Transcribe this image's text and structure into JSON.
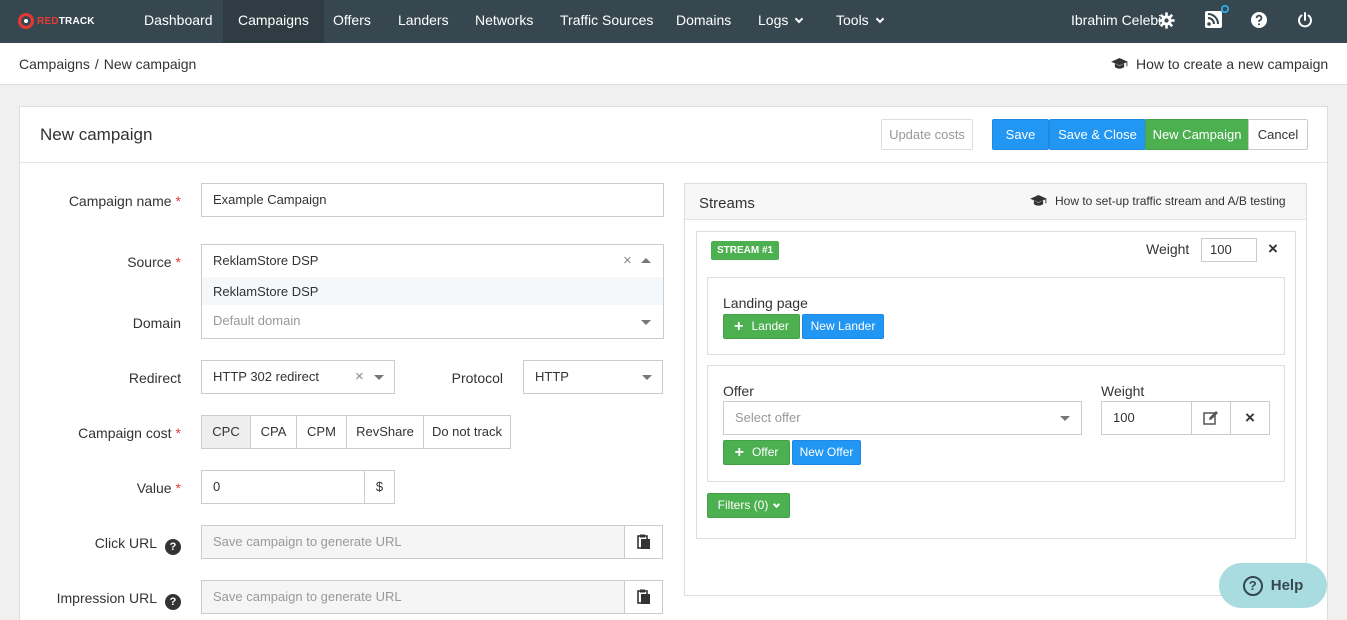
{
  "logo": {
    "text_red": "RED",
    "text_white": "TRACK"
  },
  "nav": {
    "items": [
      "Dashboard",
      "Campaigns",
      "Offers",
      "Landers",
      "Networks",
      "Traffic Sources",
      "Domains",
      "Logs",
      "Tools"
    ],
    "active": "Campaigns",
    "user_name": "Ibrahim Celebi"
  },
  "breadcrumb": {
    "parent": "Campaigns",
    "separator": "/",
    "current": "New campaign"
  },
  "howto_link": "How to create a new campaign",
  "card": {
    "title": "New campaign",
    "buttons": {
      "update_costs": "Update costs",
      "save": "Save",
      "save_close": "Save & Close",
      "new_campaign": "New Campaign",
      "cancel": "Cancel"
    }
  },
  "form": {
    "campaign_name": {
      "label": "Campaign name",
      "value": "Example Campaign"
    },
    "source": {
      "label": "Source",
      "value": "ReklamStore DSP",
      "dropdown_option": "ReklamStore DSP"
    },
    "domain": {
      "label": "Domain",
      "placeholder": "Default domain"
    },
    "redirect": {
      "label": "Redirect",
      "value": "HTTP 302 redirect"
    },
    "protocol": {
      "label": "Protocol",
      "value": "HTTP"
    },
    "campaign_cost": {
      "label": "Campaign cost",
      "options": [
        "CPC",
        "CPA",
        "CPM",
        "RevShare",
        "Do not track"
      ],
      "selected": "CPC"
    },
    "value": {
      "label": "Value",
      "value": "0",
      "currency": "$"
    },
    "click_url": {
      "label": "Click URL",
      "placeholder": "Save campaign to generate URL"
    },
    "impression_url": {
      "label": "Impression URL",
      "placeholder": "Save campaign to generate URL"
    },
    "required_mark": "*",
    "help_mark": "?"
  },
  "streams": {
    "title": "Streams",
    "howto": "How to set-up traffic stream and A/B testing",
    "stream": {
      "badge": "STREAM #1",
      "weight_label": "Weight",
      "weight_value": "100",
      "landing_label": "Landing page",
      "add_lander": "Lander",
      "new_lander": "New Lander",
      "offer_label": "Offer",
      "offer_placeholder": "Select offer",
      "offer_weight_label": "Weight",
      "offer_weight_value": "100",
      "add_offer": "Offer",
      "new_offer": "New Offer",
      "filters": "Filters (0)"
    }
  },
  "help_button": {
    "label": "Help",
    "glyph": "?"
  },
  "colors": {
    "nav_bg": "#37474f",
    "primary": "#2196f3",
    "success": "#4caf50",
    "danger": "#e53935",
    "help_bg": "#a8dce0"
  }
}
